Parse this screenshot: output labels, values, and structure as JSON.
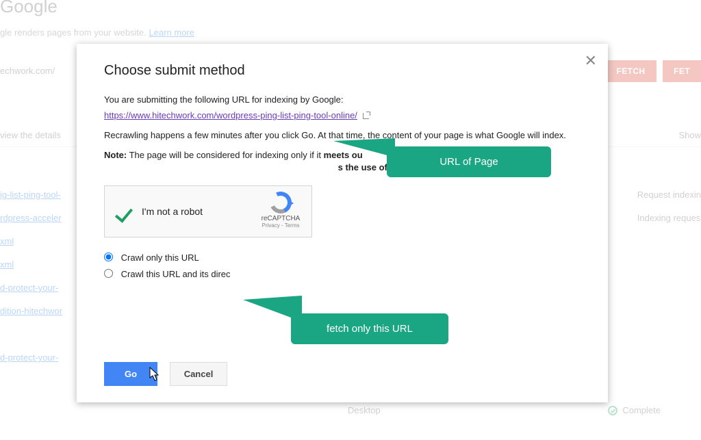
{
  "background": {
    "page_title_fragment": "Google",
    "subtitle_fragment": "gle renders pages from your website.",
    "learn_more": "Learn more",
    "url_fragment": "echwork.com/",
    "fetch_btn": "FETCH",
    "fetch_render_btn": "FET",
    "view_details": "view the details",
    "show_label": "Show",
    "left_links": [
      "ig-list-ping-tool-",
      "rdpress-acceler",
      "xml",
      "xml",
      "d-protect-your-",
      "dition-hitechwor",
      "d-protect-your-"
    ],
    "right_items": [
      "Request indexin",
      "Indexing reques"
    ],
    "desktop_label": "Desktop",
    "complete_label": "Complete"
  },
  "modal": {
    "title": "Choose submit method",
    "intro": "You are submitting the following URL for indexing by Google:",
    "url": "https://www.hitechwork.com/wordpress-ping-list-ping-tool-online/",
    "recrawl_text": "Recrawling happens a few minutes after you click Go. At that time, the content of your page is what Google will index.",
    "note_label": "Note:",
    "note_mid": " The page will be considered for indexing only if it ",
    "note_bold1": "meets ou",
    "note_bold2": "s the use of noindex directives",
    "captcha": {
      "robot_text": "I'm not a robot",
      "brand": "reCAPTCHA",
      "legal": "Privacy - Terms"
    },
    "radio1": "Crawl only this URL",
    "radio2": "Crawl this URL and its direct links",
    "radio2_visible": "Crawl this URL and its direc",
    "go": "Go",
    "cancel": "Cancel"
  },
  "callouts": {
    "url_label": "URL of Page",
    "fetch_label": "fetch only this URL"
  }
}
